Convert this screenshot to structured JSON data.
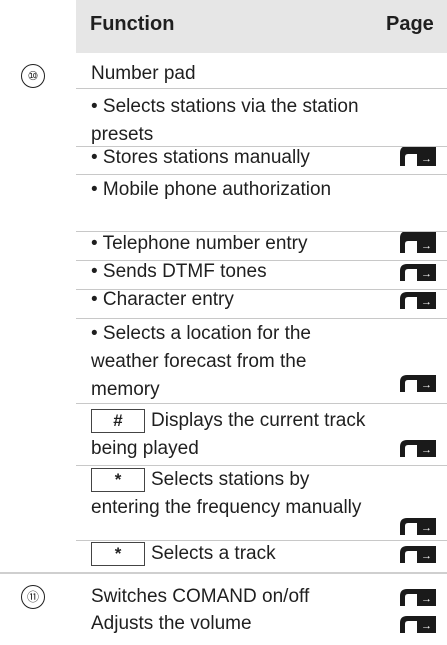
{
  "header": {
    "function": "Function",
    "page": "Page"
  },
  "sections": [
    {
      "number": "⑩",
      "rows": [
        {
          "text": "Number pad"
        },
        {
          "text": "• Selects stations via the station presets"
        },
        {
          "text": "• Stores stations manually"
        },
        {
          "text": "• Mobile phone authorization"
        },
        {
          "text": "• Telephone number entry"
        },
        {
          "text": "• Sends DTMF tones"
        },
        {
          "text": "• Character entry"
        },
        {
          "text": "• Selects a location for the weather forecast from the memory"
        },
        {
          "key": "#",
          "text": "Displays the current track being played"
        },
        {
          "key": "*",
          "text": "Selects stations by entering the frequency manually"
        },
        {
          "key": "*",
          "text": "Selects a track"
        }
      ]
    },
    {
      "number": "⑪",
      "rows": [
        {
          "text": "Switches COMAND on/off"
        },
        {
          "text": "Adjusts the volume"
        }
      ]
    }
  ]
}
